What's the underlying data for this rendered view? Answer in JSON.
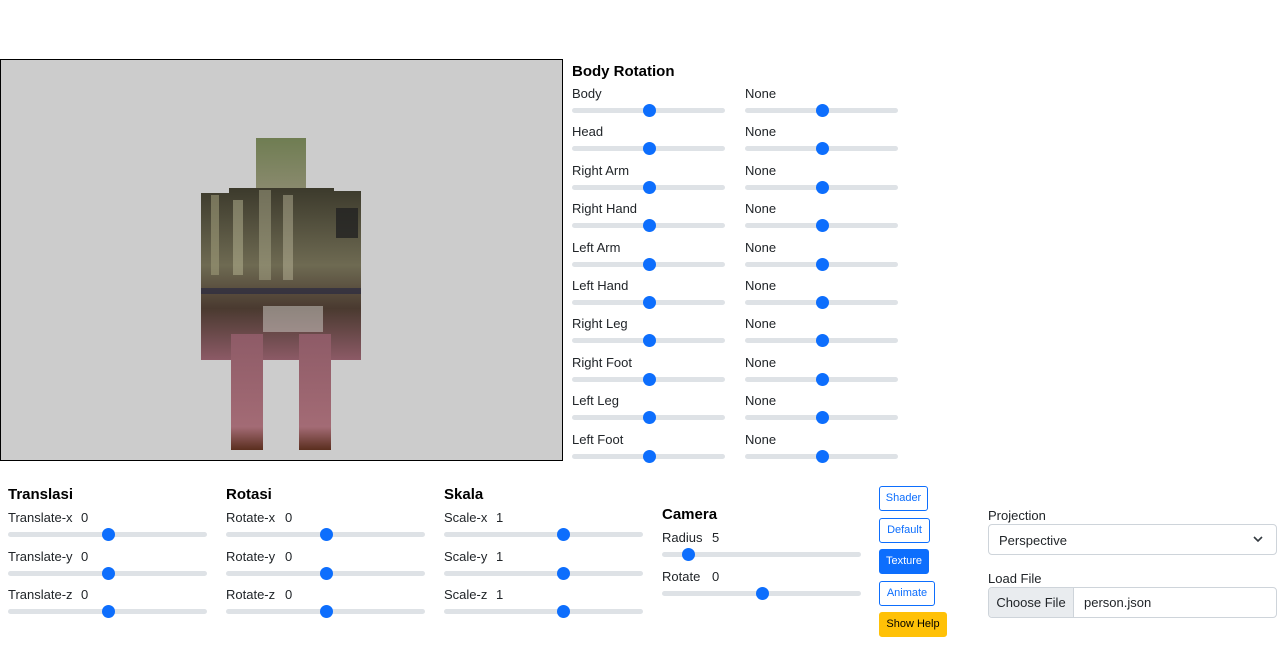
{
  "body_rotation": {
    "title": "Body Rotation",
    "rows": [
      {
        "label": "Body",
        "value": "None",
        "slider1": 0.5,
        "slider2": 0.5
      },
      {
        "label": "Head",
        "value": "None",
        "slider1": 0.5,
        "slider2": 0.5
      },
      {
        "label": "Right Arm",
        "value": "None",
        "slider1": 0.5,
        "slider2": 0.5
      },
      {
        "label": "Right Hand",
        "value": "None",
        "slider1": 0.5,
        "slider2": 0.5
      },
      {
        "label": "Left Arm",
        "value": "None",
        "slider1": 0.5,
        "slider2": 0.5
      },
      {
        "label": "Left Hand",
        "value": "None",
        "slider1": 0.5,
        "slider2": 0.5
      },
      {
        "label": "Right Leg",
        "value": "None",
        "slider1": 0.5,
        "slider2": 0.5
      },
      {
        "label": "Right Foot",
        "value": "None",
        "slider1": 0.5,
        "slider2": 0.5
      },
      {
        "label": "Left Leg",
        "value": "None",
        "slider1": 0.5,
        "slider2": 0.5
      },
      {
        "label": "Left Foot",
        "value": "None",
        "slider1": 0.5,
        "slider2": 0.5
      }
    ]
  },
  "translasi": {
    "title": "Translasi",
    "rows": [
      {
        "label": "Translate-x",
        "value": "0",
        "level": 0.5
      },
      {
        "label": "Translate-y",
        "value": "0",
        "level": 0.5
      },
      {
        "label": "Translate-z",
        "value": "0",
        "level": 0.5
      }
    ]
  },
  "rotasi": {
    "title": "Rotasi",
    "rows": [
      {
        "label": "Rotate-x",
        "value": "0",
        "level": 0.5
      },
      {
        "label": "Rotate-y",
        "value": "0",
        "level": 0.5
      },
      {
        "label": "Rotate-z",
        "value": "0",
        "level": 0.5
      }
    ]
  },
  "skala": {
    "title": "Skala",
    "rows": [
      {
        "label": "Scale-x",
        "value": "1",
        "level": 0.6
      },
      {
        "label": "Scale-y",
        "value": "1",
        "level": 0.6
      },
      {
        "label": "Scale-z",
        "value": "1",
        "level": 0.6
      }
    ]
  },
  "camera": {
    "title": "Camera",
    "rows": [
      {
        "label": "Radius",
        "value": "5",
        "level": 0.13
      },
      {
        "label": "Rotate",
        "value": "0",
        "level": 0.5
      }
    ]
  },
  "buttons": {
    "shader": "Shader",
    "default": "Default",
    "texture": "Texture",
    "animate": "Animate",
    "show_help": "Show Help"
  },
  "projection": {
    "label": "Projection",
    "selected": "Perspective"
  },
  "load_file": {
    "label": "Load File",
    "choose": "Choose File",
    "filename": "person.json"
  },
  "colors": {
    "accent": "#0d6efd",
    "warning": "#ffc107",
    "canvas_bg": "#cccccc"
  }
}
